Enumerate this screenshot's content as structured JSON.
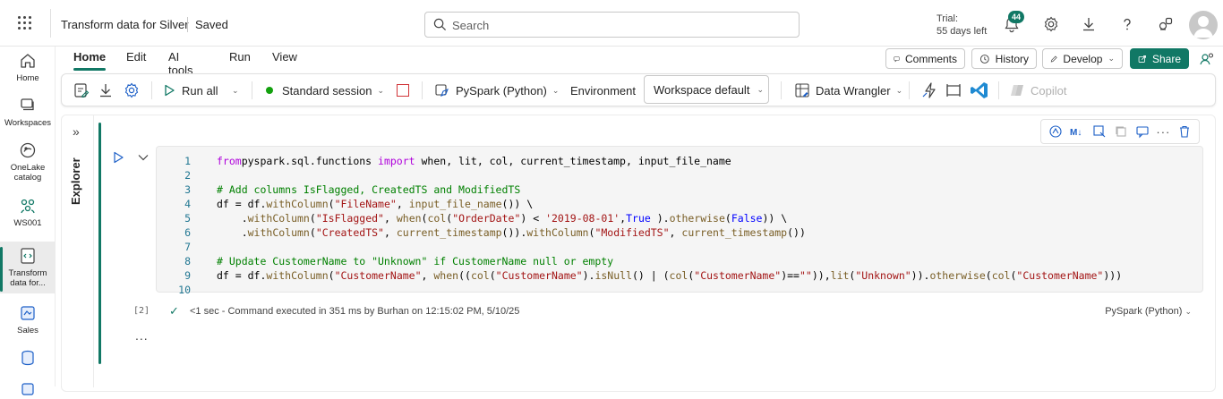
{
  "topbar": {
    "title": "Transform data for Silver",
    "saved": "Saved",
    "search_placeholder": "Search",
    "trial_label": "Trial:",
    "trial_days": "55 days left",
    "notifications_count": "44"
  },
  "leftnav": {
    "items": [
      {
        "label": "Home",
        "icon": "home-icon"
      },
      {
        "label": "Workspaces",
        "icon": "workspaces-icon"
      },
      {
        "label": "OneLake catalog",
        "icon": "onelake-icon"
      },
      {
        "label": "WS001",
        "icon": "workspace-icon"
      },
      {
        "label": "Transform data for...",
        "icon": "notebook-icon"
      },
      {
        "label": "Sales",
        "icon": "lakehouse-icon"
      }
    ]
  },
  "tabs": [
    "Home",
    "Edit",
    "AI tools",
    "Run",
    "View"
  ],
  "header_buttons": {
    "comments": "Comments",
    "history": "History",
    "develop": "Develop",
    "share": "Share"
  },
  "ribbon": {
    "run_all": "Run all",
    "session": "Standard session",
    "language": "PySpark (Python)",
    "environment_label": "Environment",
    "environment_value": "Workspace default",
    "data_wrangler": "Data Wrangler",
    "copilot": "Copilot"
  },
  "explorer": {
    "label": "Explorer"
  },
  "cell": {
    "lines": [
      {
        "n": "1",
        "tokens": [
          [
            "kw",
            "from"
          ],
          [
            "",
            "pyspark.sql.functions "
          ],
          [
            "kw",
            "import"
          ],
          [
            "",
            " when, lit, col, current_timestamp, input_file_name"
          ]
        ]
      },
      {
        "n": "2",
        "tokens": []
      },
      {
        "n": "3",
        "tokens": [
          [
            "cm",
            "# Add columns IsFlagged, CreatedTS and ModifiedTS"
          ]
        ]
      },
      {
        "n": "4",
        "tokens": [
          [
            "",
            "df = df."
          ],
          [
            "fn",
            "withColumn"
          ],
          [
            "",
            "("
          ],
          [
            "str",
            "\"FileName\""
          ],
          [
            "",
            ", "
          ],
          [
            "fn",
            "input_file_name"
          ],
          [
            "",
            "()) \\"
          ]
        ]
      },
      {
        "n": "5",
        "tokens": [
          [
            "",
            "    ."
          ],
          [
            "fn",
            "withColumn"
          ],
          [
            "",
            "("
          ],
          [
            "str",
            "\"IsFlagged\""
          ],
          [
            "",
            ", "
          ],
          [
            "fn",
            "when"
          ],
          [
            "",
            "("
          ],
          [
            "fn",
            "col"
          ],
          [
            "",
            "("
          ],
          [
            "str",
            "\"OrderDate\""
          ],
          [
            "",
            ") < "
          ],
          [
            "str",
            "'2019-08-01'"
          ],
          [
            "",
            ","
          ],
          [
            "bool",
            "True"
          ],
          [
            "",
            " )."
          ],
          [
            "fn",
            "otherwise"
          ],
          [
            "",
            "("
          ],
          [
            "bool",
            "False"
          ],
          [
            "",
            "))"
          ],
          [
            "",
            " \\"
          ]
        ]
      },
      {
        "n": "6",
        "tokens": [
          [
            "",
            "    ."
          ],
          [
            "fn",
            "withColumn"
          ],
          [
            "",
            "("
          ],
          [
            "str",
            "\"CreatedTS\""
          ],
          [
            "",
            ", "
          ],
          [
            "fn",
            "current_timestamp"
          ],
          [
            "",
            "())."
          ],
          [
            "fn",
            "withColumn"
          ],
          [
            "",
            "("
          ],
          [
            "str",
            "\"ModifiedTS\""
          ],
          [
            "",
            ", "
          ],
          [
            "fn",
            "current_timestamp"
          ],
          [
            "",
            "())"
          ]
        ]
      },
      {
        "n": "7",
        "tokens": []
      },
      {
        "n": "8",
        "tokens": [
          [
            "cm",
            "# Update CustomerName to \"Unknown\" if CustomerName null or empty"
          ]
        ]
      },
      {
        "n": "9",
        "tokens": [
          [
            "",
            "df = df."
          ],
          [
            "fn",
            "withColumn"
          ],
          [
            "",
            "("
          ],
          [
            "str",
            "\"CustomerName\""
          ],
          [
            "",
            ", "
          ],
          [
            "fn",
            "when"
          ],
          [
            "",
            "(("
          ],
          [
            "fn",
            "col"
          ],
          [
            "",
            "("
          ],
          [
            "str",
            "\"CustomerName\""
          ],
          [
            "",
            ")."
          ],
          [
            "fn",
            "isNull"
          ],
          [
            "",
            "() | ("
          ],
          [
            "fn",
            "col"
          ],
          [
            "",
            "("
          ],
          [
            "str",
            "\"CustomerName\""
          ],
          [
            "",
            ")=="
          ],
          [
            "str",
            "\"\""
          ],
          [
            "",
            "))"
          ],
          [
            "",
            ","
          ],
          [
            "fn",
            "lit"
          ],
          [
            "",
            "("
          ],
          [
            "str",
            "\"Unknown\""
          ],
          [
            "",
            "))."
          ],
          [
            "fn",
            "otherwise"
          ],
          [
            "",
            "("
          ],
          [
            "fn",
            "col"
          ],
          [
            "",
            "("
          ],
          [
            "str",
            "\"CustomerName\""
          ],
          [
            "",
            ")))"
          ]
        ]
      },
      {
        "n": "10",
        "tokens": []
      }
    ],
    "exec_index": "[2]",
    "status_text": "<1 sec - Command executed in 351 ms by Burhan on 12:15:02 PM, 5/10/25",
    "status_lang": "PySpark (Python)",
    "more": "..."
  }
}
